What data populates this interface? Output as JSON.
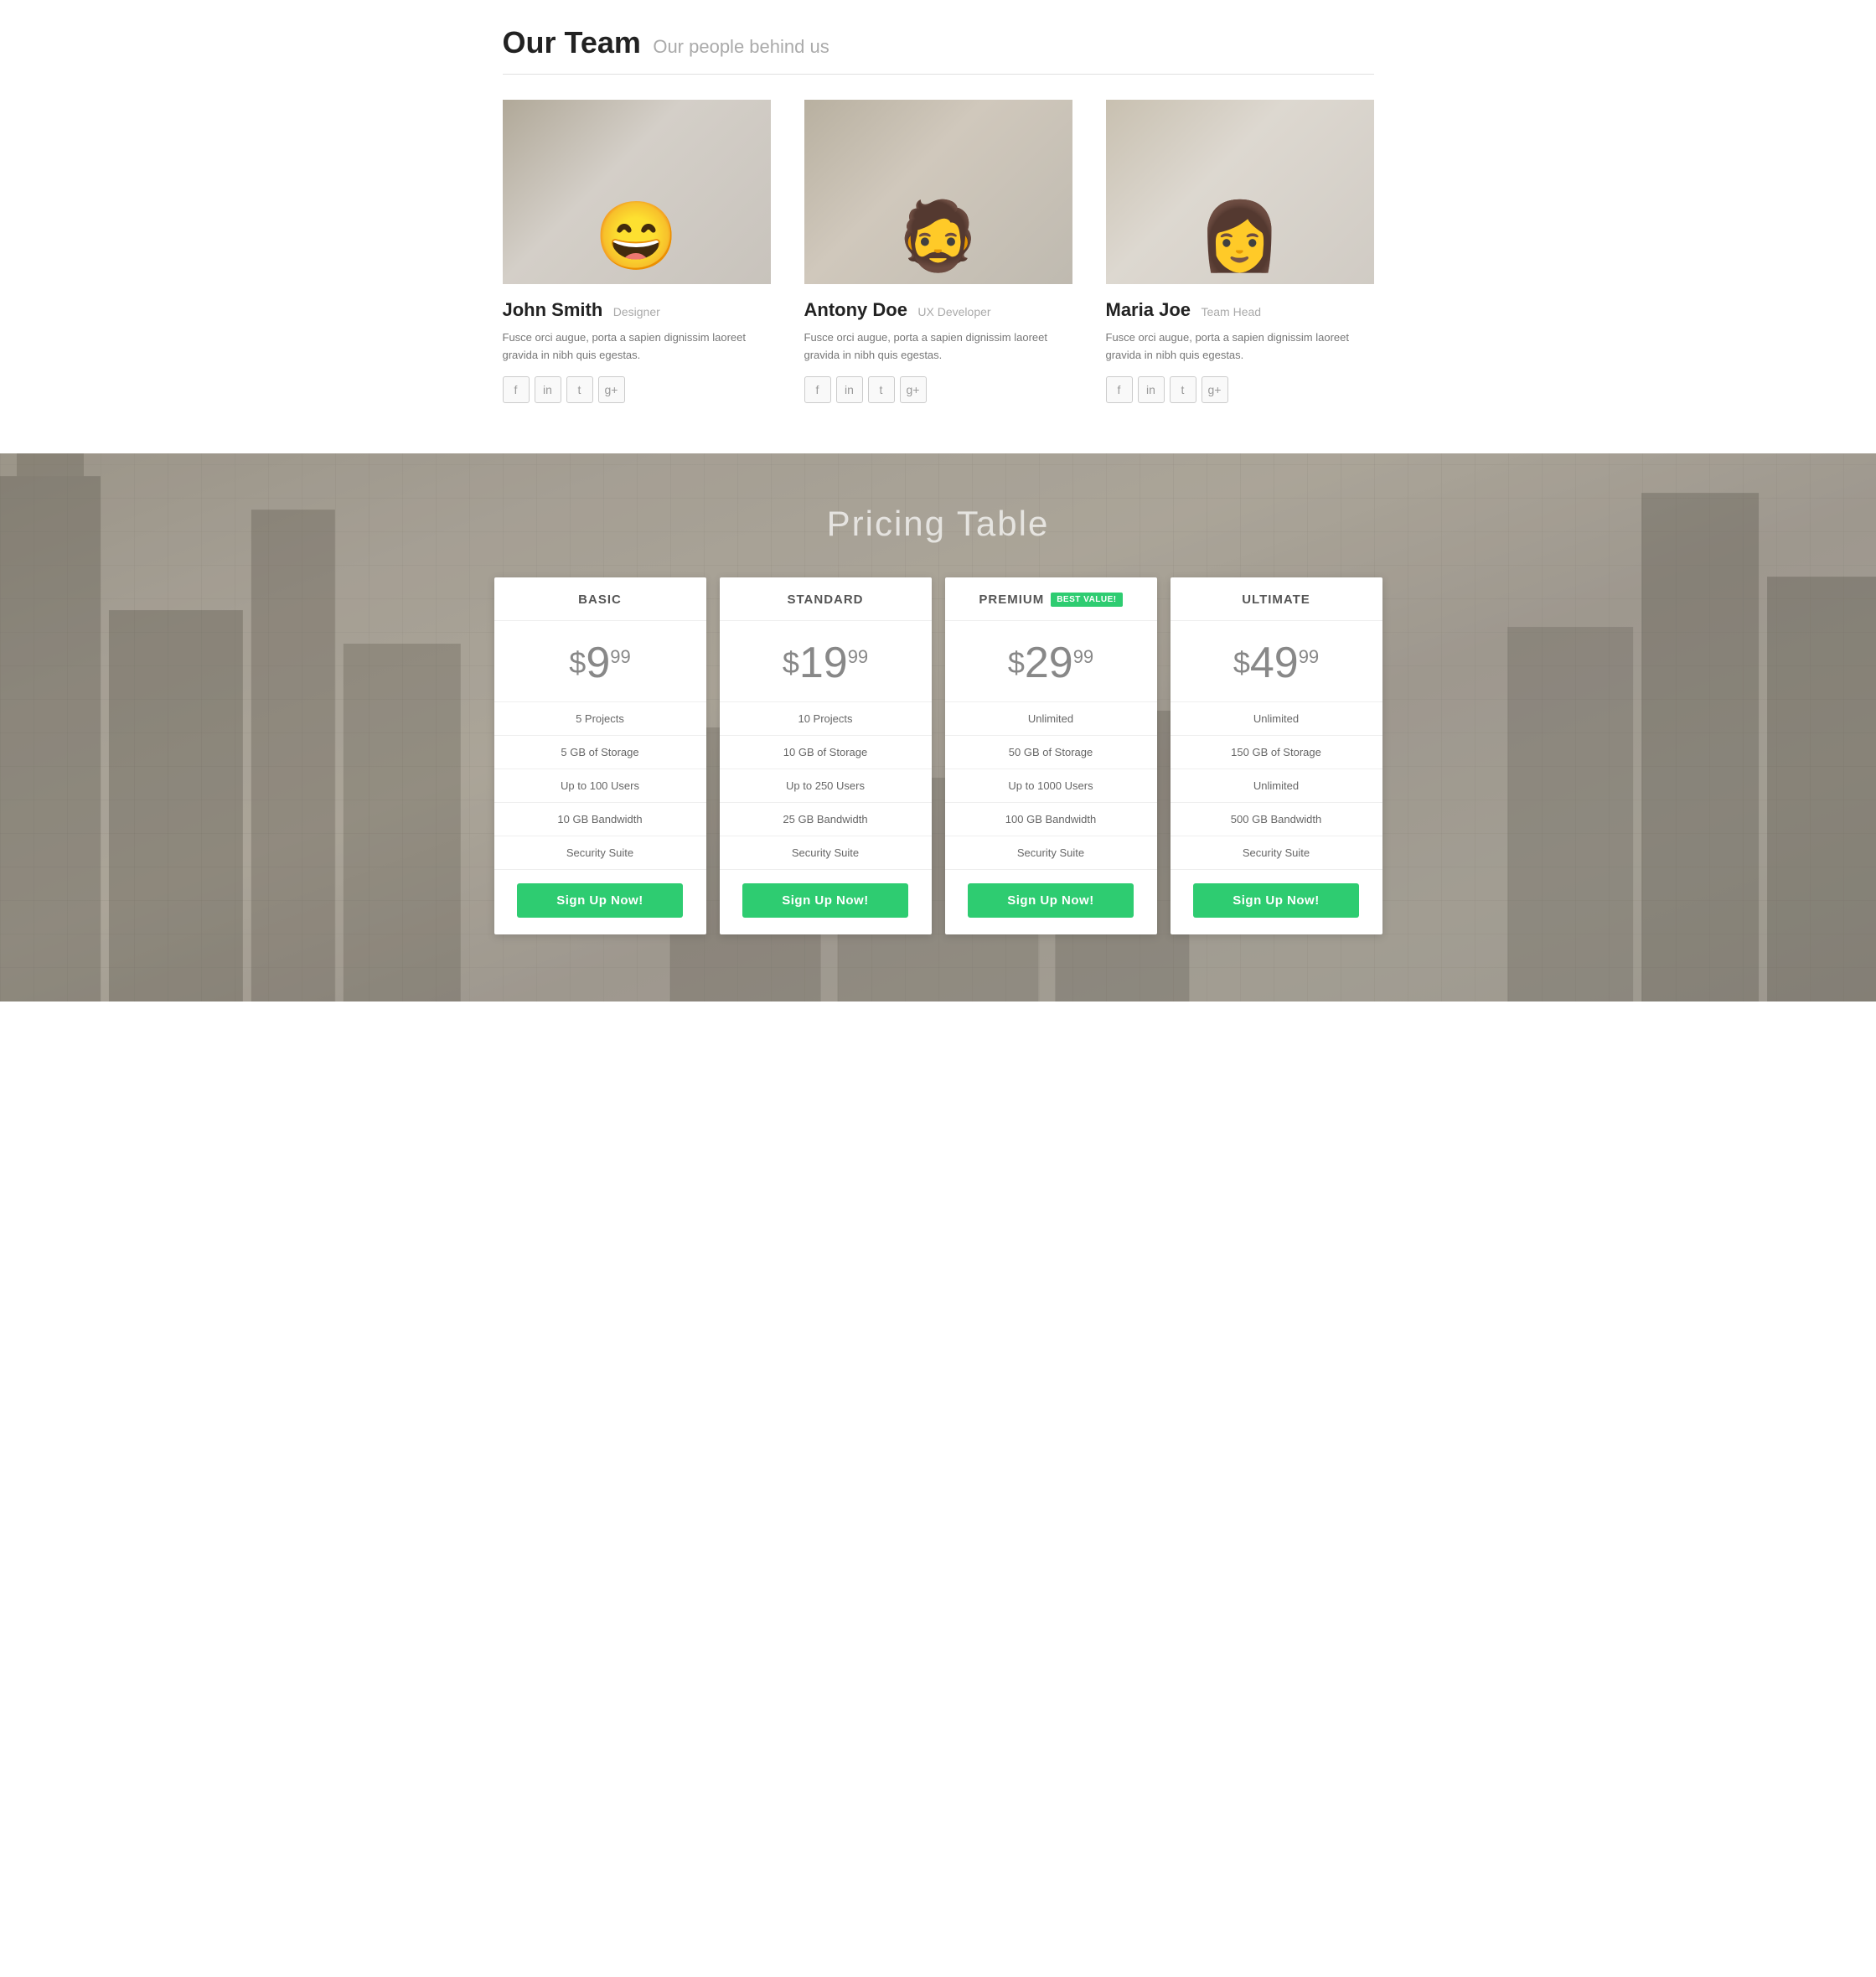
{
  "team": {
    "section_title": "Our Team",
    "section_subtitle": "Our people behind us",
    "members": [
      {
        "name": "John Smith",
        "role": "Designer",
        "bio": "Fusce orci augue, porta a sapien dignissim laoreet gravida in nibh quis egestas.",
        "photo_class": "photo-1"
      },
      {
        "name": "Antony Doe",
        "role": "UX Developer",
        "bio": "Fusce orci augue, porta a sapien dignissim laoreet gravida in nibh quis egestas.",
        "photo_class": "photo-2"
      },
      {
        "name": "Maria Joe",
        "role": "Team Head",
        "bio": "Fusce orci augue, porta a sapien dignissim laoreet gravida in nibh quis egestas.",
        "photo_class": "photo-3"
      }
    ],
    "social_icons": [
      "f",
      "in",
      "t",
      "g+"
    ]
  },
  "pricing": {
    "section_title": "Pricing Table",
    "plans": [
      {
        "name": "BASIC",
        "badge": null,
        "price_main": "$9",
        "price_cents": "99",
        "features": [
          "5 Projects",
          "5 GB of Storage",
          "Up to 100 Users",
          "10 GB Bandwidth",
          "Security Suite"
        ],
        "cta": "Sign Up Now!"
      },
      {
        "name": "STANDARD",
        "badge": null,
        "price_main": "$19",
        "price_cents": "99",
        "features": [
          "10 Projects",
          "10 GB of Storage",
          "Up to 250 Users",
          "25 GB Bandwidth",
          "Security Suite"
        ],
        "cta": "Sign Up Now!"
      },
      {
        "name": "PREMIUM",
        "badge": "BEST VALUE!",
        "price_main": "$29",
        "price_cents": "99",
        "features": [
          "Unlimited",
          "50 GB of Storage",
          "Up to 1000 Users",
          "100 GB Bandwidth",
          "Security Suite"
        ],
        "cta": "Sign Up Now!"
      },
      {
        "name": "ULTIMATE",
        "badge": null,
        "price_main": "$49",
        "price_cents": "99",
        "features": [
          "Unlimited",
          "150 GB of Storage",
          "Unlimited",
          "500 GB Bandwidth",
          "Security Suite"
        ],
        "cta": "Sign Up Now!"
      }
    ]
  }
}
